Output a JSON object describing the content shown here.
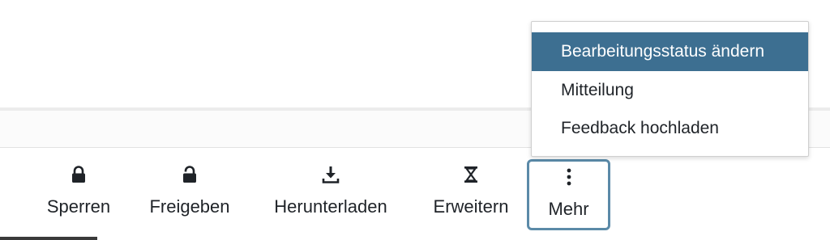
{
  "toolbar": {
    "buttons": [
      {
        "label": "Sperren",
        "icon": "lock-icon"
      },
      {
        "label": "Freigeben",
        "icon": "unlock-icon"
      },
      {
        "label": "Herunterladen",
        "icon": "download-icon"
      },
      {
        "label": "Erweitern",
        "icon": "hourglass-icon"
      },
      {
        "label": "Mehr",
        "icon": "more-vertical-icon"
      }
    ]
  },
  "menu": {
    "items": [
      {
        "label": "Bearbeitungsstatus ändern",
        "selected": true
      },
      {
        "label": "Mitteilung",
        "selected": false
      },
      {
        "label": "Feedback hochladen",
        "selected": false
      }
    ]
  },
  "colors": {
    "accent": "#3d6f91",
    "focus_ring": "#5b8aa8",
    "text": "#1f2328"
  }
}
